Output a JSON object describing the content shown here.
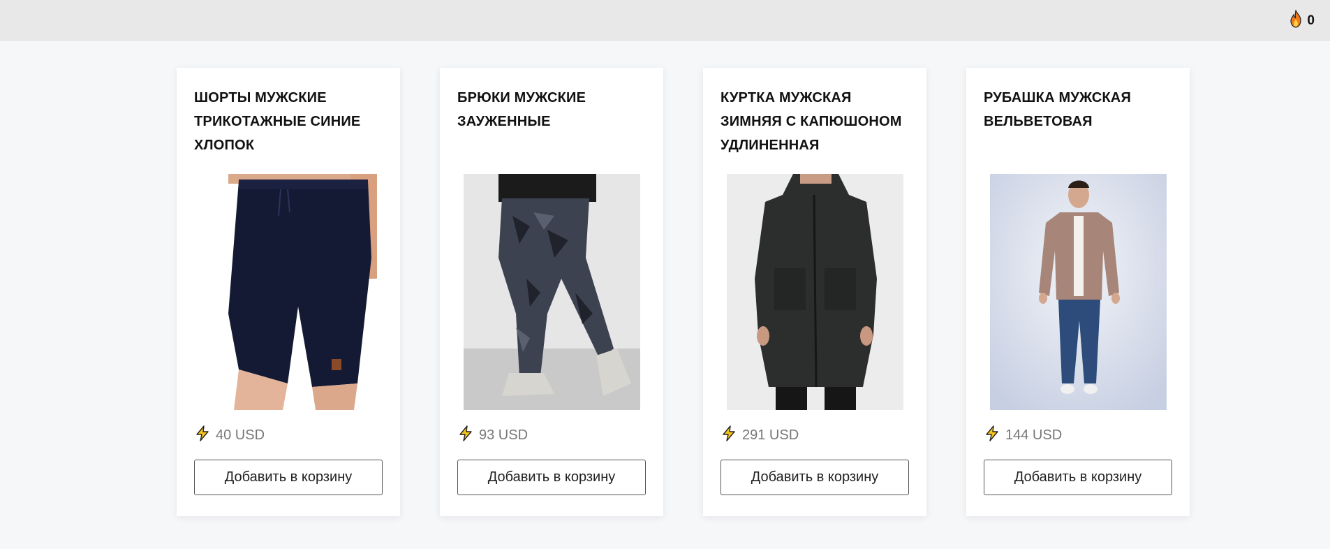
{
  "header": {
    "cart_count": "0",
    "cart_icon": "flame-icon"
  },
  "products": [
    {
      "title": "ШОРТЫ МУЖСКИЕ ТРИКОТАЖНЫЕ СИНИЕ ХЛОПОК",
      "price": "40 USD",
      "button_label": "Добавить в корзину",
      "image_alt": "Navy knit shorts",
      "price_icon": "lightning-icon"
    },
    {
      "title": "БРЮКИ МУЖСКИЕ ЗАУЖЕННЫЕ",
      "price": "93 USD",
      "button_label": "Добавить в корзину",
      "image_alt": "Camo slim pants",
      "price_icon": "lightning-icon"
    },
    {
      "title": "КУРТКА МУЖСКАЯ ЗИМНЯЯ С КАПЮШОНОМ УДЛИНЕННАЯ",
      "price": "291 USD",
      "button_label": "Добавить в корзину",
      "image_alt": "Long black hooded winter parka",
      "price_icon": "lightning-icon"
    },
    {
      "title": "РУБАШКА МУЖСКАЯ ВЕЛЬВЕТОВАЯ",
      "price": "144 USD",
      "button_label": "Добавить в корзину",
      "image_alt": "Brown corduroy shirt",
      "price_icon": "lightning-icon"
    }
  ],
  "colors": {
    "topbar": "#e8e8e8",
    "background": "#f6f7f9",
    "lightning": "#f5c518",
    "flame": "#f27a1a"
  }
}
